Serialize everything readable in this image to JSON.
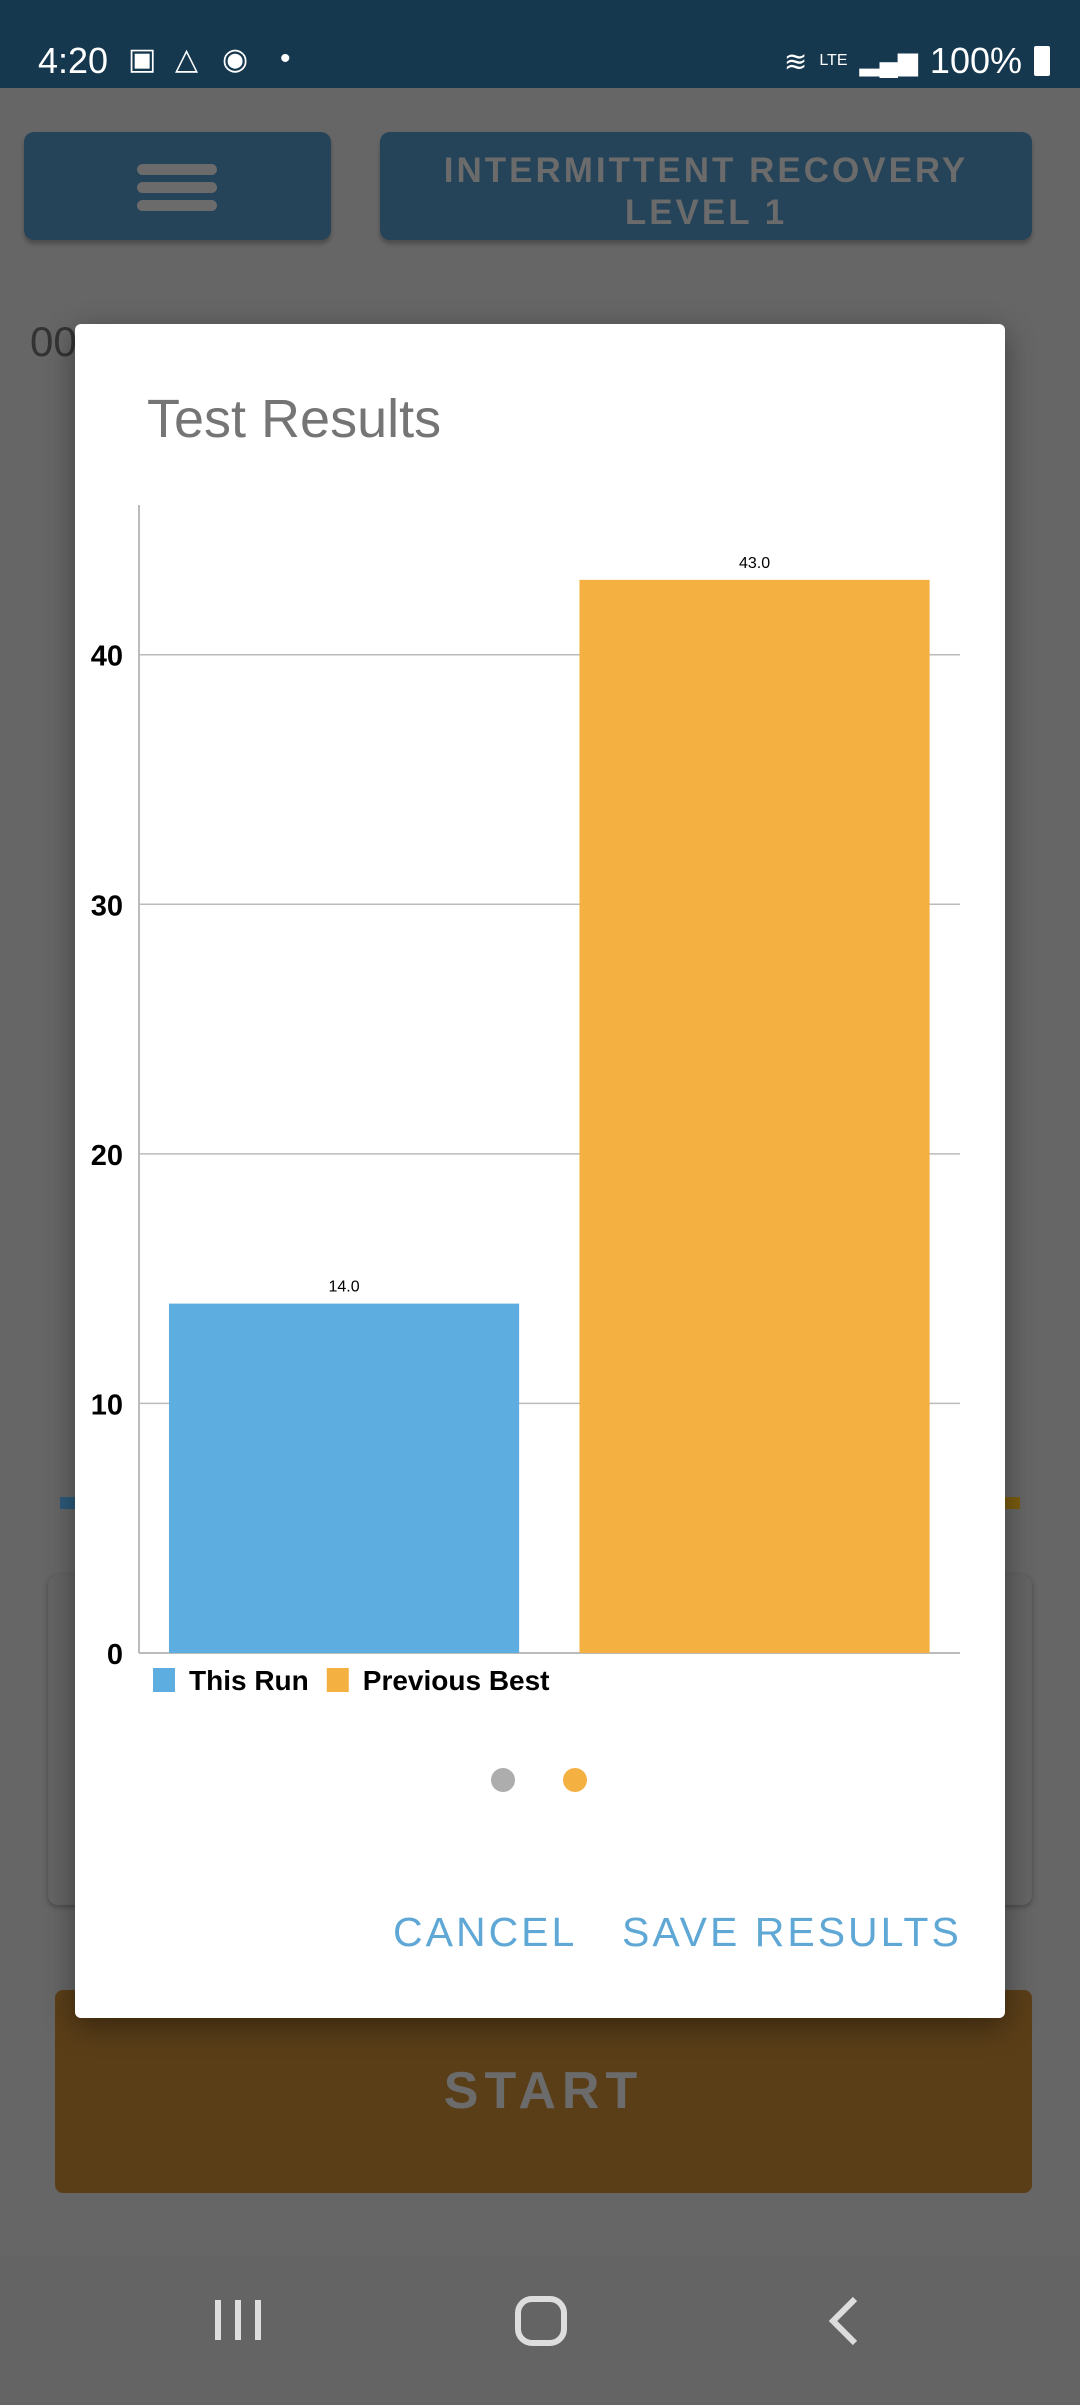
{
  "status_bar": {
    "time": "4:20",
    "battery": "100%",
    "network": "LTE",
    "notification_icons": [
      "gallery-icon",
      "drive-icon",
      "messenger-icon",
      "dot-icon"
    ]
  },
  "background": {
    "menu_icon": "hamburger-icon",
    "mode_line1": "INTERMITTENT RECOVERY",
    "mode_line2": "LEVEL 1",
    "timer": "00",
    "start_label": "START"
  },
  "dialog": {
    "title": "Test Results",
    "cancel_label": "CANCEL",
    "save_label": "SAVE RESULTS",
    "pager": {
      "pages": 2,
      "active": 2
    }
  },
  "colors": {
    "this_run": "#5dade0",
    "previous_best": "#f5b042",
    "accent": "#5fa8d6",
    "status_bar": "#15384f"
  },
  "chart_data": {
    "type": "bar",
    "categories": [
      "This Run",
      "Previous Best"
    ],
    "series": [
      {
        "name": "This Run",
        "values": [
          14.0
        ]
      },
      {
        "name": "Previous Best",
        "values": [
          43.0
        ]
      }
    ],
    "values": [
      14.0,
      43.0
    ],
    "data_labels": [
      "14.0",
      "43.0"
    ],
    "yticks": [
      "0",
      "10",
      "20",
      "30",
      "40"
    ],
    "ylim": [
      0,
      46
    ],
    "grid": true,
    "legend": "bottom-left"
  }
}
